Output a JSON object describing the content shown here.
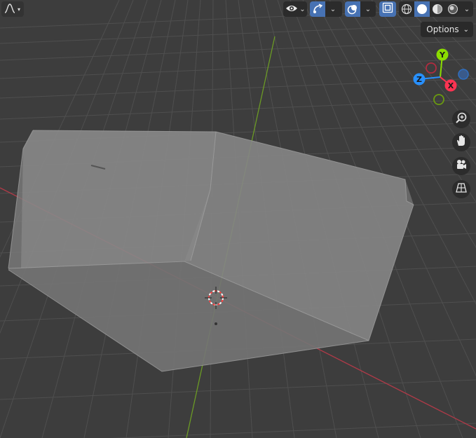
{
  "header": {
    "options_label": "Options",
    "editor_type_icon": "curve-editor-icon",
    "visibility_icon": "eye-icon",
    "gizmo_icon": "gizmo-icon",
    "overlay_icon": "overlay-icon",
    "xray_icon": "xray-icon",
    "shading_modes": [
      "wireframe",
      "solid",
      "material-preview",
      "rendered"
    ],
    "active_shading_mode": "solid"
  },
  "gizmo": {
    "axis_x_label": "X",
    "axis_y_label": "Y",
    "axis_z_label": "Z",
    "colors": {
      "x": "#ff3352",
      "y": "#8bdc00",
      "z": "#2890ff"
    }
  },
  "nav_tools": [
    "zoom-icon",
    "hand-pan-icon",
    "camera-icon",
    "perspective-grid-icon"
  ],
  "colors": {
    "background": "#3d3d3d",
    "grid": "#4f4f4f",
    "x_axis_line": "#b03a48",
    "y_axis_line": "#6b9a25",
    "object": "#888888",
    "accent": "#4772b3"
  }
}
